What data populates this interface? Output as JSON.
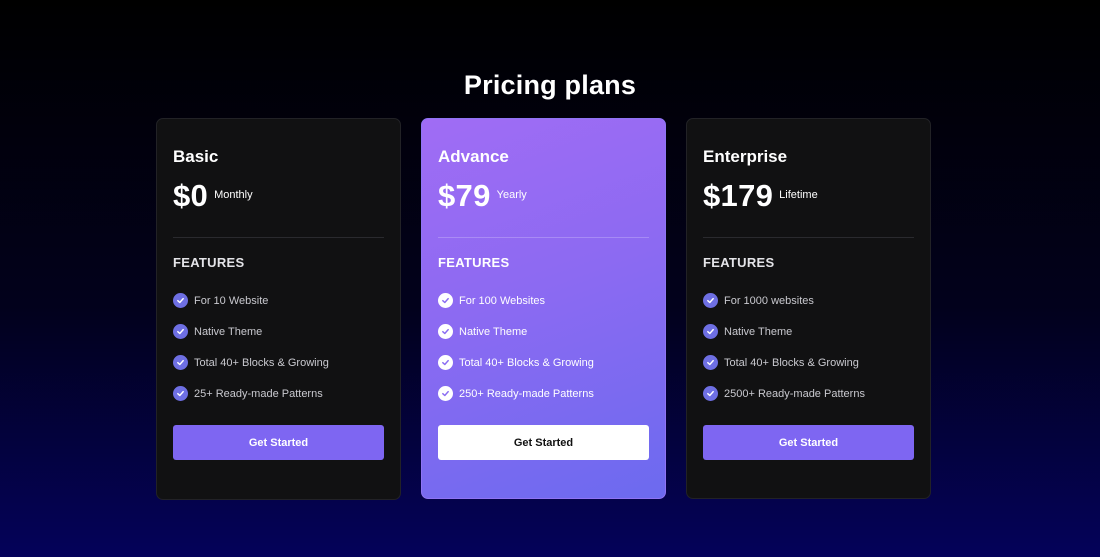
{
  "page": {
    "title": "Pricing plans"
  },
  "plans": [
    {
      "name": "Basic",
      "price": "$0",
      "period": "Monthly",
      "features_title": "FEATURES",
      "features": [
        "For 10 Website",
        "Native Theme",
        "Total 40+ Blocks & Growing",
        "25+ Ready-made Patterns"
      ],
      "cta": "Get Started",
      "featured": false
    },
    {
      "name": "Advance",
      "price": "$79",
      "period": "Yearly",
      "features_title": "FEATURES",
      "features": [
        "For 100 Websites",
        "Native Theme",
        "Total 40+ Blocks & Growing",
        "250+ Ready-made Patterns"
      ],
      "cta": "Get Started",
      "featured": true
    },
    {
      "name": "Enterprise",
      "price": "$179",
      "period": "Lifetime",
      "features_title": "FEATURES",
      "features": [
        "For 1000 websites",
        "Native Theme",
        "Total 40+ Blocks & Growing",
        "2500+ Ready-made Patterns"
      ],
      "cta": "Get Started",
      "featured": false
    }
  ],
  "icons": {
    "feature_check": "check-circle-icon"
  },
  "colors": {
    "accent": "#7e66f2",
    "featured_gradient_start": "#a06cf4",
    "featured_gradient_end": "#6c6aef",
    "card_bg": "#111112"
  }
}
